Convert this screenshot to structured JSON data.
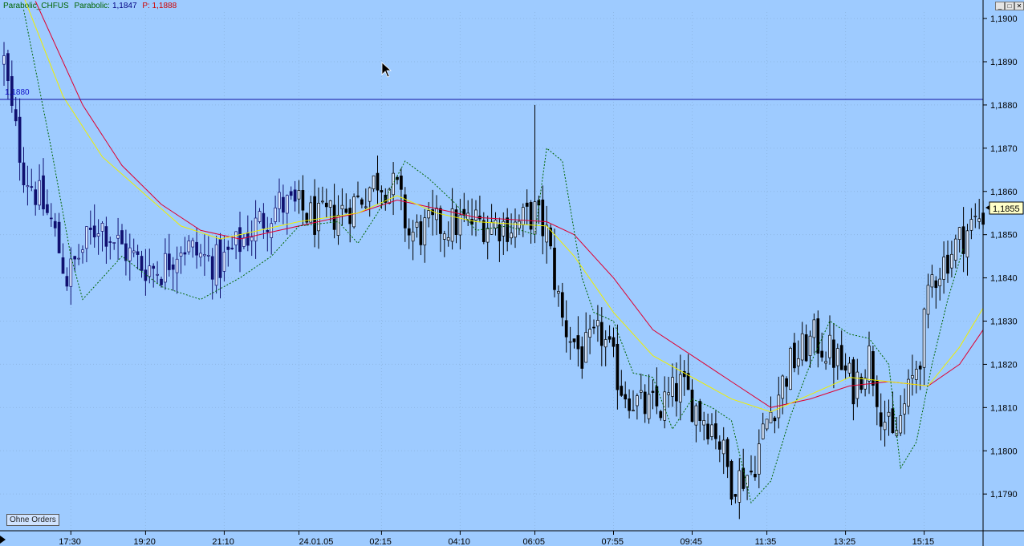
{
  "header": {
    "indicator": "Parabolic_CHFUS",
    "param_label": "Parabolic:",
    "param_value": "1,1847",
    "p_value": "P: 1,1888",
    "colors": {
      "indicator": "#006400",
      "param": "#000080",
      "p": "#d00000"
    }
  },
  "window_controls": {
    "minimize_icon": "_",
    "restore_icon": "□",
    "close_icon": "✕"
  },
  "buttons": {
    "ohne_orders": "Ohne Orders"
  },
  "hline_label": "1,1880",
  "current_price": "1,1855",
  "chart_data": {
    "type": "candlestick",
    "y_ticks": [
      "1,1790",
      "1,1800",
      "1,1810",
      "1,1820",
      "1,1830",
      "1,1840",
      "1,1850",
      "1,1860",
      "1,1870",
      "1,1880",
      "1,1890",
      "1,1900"
    ],
    "y_tick_values": [
      1.179,
      1.18,
      1.181,
      1.182,
      1.183,
      1.184,
      1.185,
      1.186,
      1.187,
      1.188,
      1.189,
      1.19
    ],
    "ylim": [
      1.17815,
      1.19015
    ],
    "x_ticks": [
      "17:30",
      "19:20",
      "21:10",
      "24.01.05",
      "02:15",
      "04:10",
      "06:05",
      "07:55",
      "09:45",
      "11:35",
      "13:25",
      "15:15"
    ],
    "x_tick_index": [
      17,
      36,
      56,
      75,
      96,
      116,
      135,
      155,
      175,
      194,
      214,
      234
    ],
    "n_bars": 250,
    "horizontal_line": 1.188,
    "current_price_value": 1.1855,
    "anchors": [
      [
        0,
        1.189
      ],
      [
        2,
        1.1878
      ],
      [
        5,
        1.1865
      ],
      [
        8,
        1.186
      ],
      [
        12,
        1.1853
      ],
      [
        16,
        1.184
      ],
      [
        19,
        1.1845
      ],
      [
        24,
        1.1853
      ],
      [
        30,
        1.1847
      ],
      [
        35,
        1.1843
      ],
      [
        40,
        1.1842
      ],
      [
        45,
        1.1848
      ],
      [
        50,
        1.1845
      ],
      [
        55,
        1.1843
      ],
      [
        60,
        1.1848
      ],
      [
        65,
        1.1853
      ],
      [
        70,
        1.1857
      ],
      [
        75,
        1.1856
      ],
      [
        80,
        1.1853
      ],
      [
        85,
        1.1855
      ],
      [
        90,
        1.1858
      ],
      [
        95,
        1.1863
      ],
      [
        100,
        1.186
      ],
      [
        103,
        1.185
      ],
      [
        110,
        1.1852
      ],
      [
        120,
        1.1853
      ],
      [
        130,
        1.1852
      ],
      [
        135,
        1.1855
      ],
      [
        138,
        1.185
      ],
      [
        142,
        1.183
      ],
      [
        147,
        1.1822
      ],
      [
        152,
        1.1827
      ],
      [
        157,
        1.1815
      ],
      [
        162,
        1.181
      ],
      [
        167,
        1.181
      ],
      [
        172,
        1.1815
      ],
      [
        176,
        1.181
      ],
      [
        181,
        1.1805
      ],
      [
        185,
        1.1793
      ],
      [
        190,
        1.1795
      ],
      [
        194,
        1.1807
      ],
      [
        200,
        1.182
      ],
      [
        206,
        1.1826
      ],
      [
        211,
        1.1822
      ],
      [
        216,
        1.1815
      ],
      [
        220,
        1.1822
      ],
      [
        223,
        1.181
      ],
      [
        226,
        1.1802
      ],
      [
        230,
        1.1813
      ],
      [
        233,
        1.1823
      ],
      [
        236,
        1.184
      ],
      [
        240,
        1.1845
      ],
      [
        244,
        1.185
      ],
      [
        249,
        1.1855
      ]
    ],
    "spike": {
      "index": 135,
      "high": 1.188
    },
    "series": [
      {
        "name": "red MA",
        "color": "#e00030",
        "type": "line",
        "points": [
          [
            8,
            1.1904
          ],
          [
            20,
            1.188
          ],
          [
            30,
            1.1866
          ],
          [
            40,
            1.1857
          ],
          [
            50,
            1.1851
          ],
          [
            60,
            1.1849
          ],
          [
            70,
            1.1851
          ],
          [
            80,
            1.1853
          ],
          [
            90,
            1.1855
          ],
          [
            100,
            1.1858
          ],
          [
            110,
            1.1856
          ],
          [
            120,
            1.1854
          ],
          [
            138,
            1.1853
          ],
          [
            145,
            1.185
          ],
          [
            155,
            1.184
          ],
          [
            165,
            1.1828
          ],
          [
            175,
            1.1822
          ],
          [
            185,
            1.1816
          ],
          [
            195,
            1.181
          ],
          [
            205,
            1.1812
          ],
          [
            215,
            1.1815
          ],
          [
            225,
            1.1816
          ],
          [
            235,
            1.1815
          ],
          [
            243,
            1.182
          ],
          [
            249,
            1.1828
          ]
        ]
      },
      {
        "name": "yellow MA",
        "color": "#f0f000",
        "type": "line",
        "points": [
          [
            5,
            1.1905
          ],
          [
            15,
            1.1882
          ],
          [
            25,
            1.1868
          ],
          [
            35,
            1.186
          ],
          [
            45,
            1.1852
          ],
          [
            55,
            1.1849
          ],
          [
            65,
            1.1851
          ],
          [
            75,
            1.1853
          ],
          [
            90,
            1.1855
          ],
          [
            100,
            1.1859
          ],
          [
            110,
            1.1855
          ],
          [
            120,
            1.1853
          ],
          [
            138,
            1.1852
          ],
          [
            145,
            1.1845
          ],
          [
            155,
            1.1832
          ],
          [
            165,
            1.1822
          ],
          [
            175,
            1.1817
          ],
          [
            185,
            1.1812
          ],
          [
            195,
            1.1809
          ],
          [
            205,
            1.1813
          ],
          [
            215,
            1.1817
          ],
          [
            225,
            1.1816
          ],
          [
            235,
            1.1815
          ],
          [
            243,
            1.1824
          ],
          [
            249,
            1.1833
          ]
        ]
      },
      {
        "name": "parabolic SAR",
        "color": "#006400",
        "type": "dashed",
        "points": [
          [
            5,
            1.1902
          ],
          [
            12,
            1.187
          ],
          [
            17,
            1.1845
          ],
          [
            20,
            1.1835
          ],
          [
            30,
            1.1845
          ],
          [
            40,
            1.1838
          ],
          [
            50,
            1.1835
          ],
          [
            60,
            1.184
          ],
          [
            68,
            1.1845
          ],
          [
            75,
            1.1852
          ],
          [
            85,
            1.1853
          ],
          [
            90,
            1.1848
          ],
          [
            95,
            1.1855
          ],
          [
            102,
            1.1867
          ],
          [
            108,
            1.1863
          ],
          [
            115,
            1.1857
          ],
          [
            120,
            1.1851
          ],
          [
            128,
            1.1852
          ],
          [
            135,
            1.185
          ],
          [
            138,
            1.187
          ],
          [
            142,
            1.1867
          ],
          [
            147,
            1.184
          ],
          [
            150,
            1.1832
          ],
          [
            155,
            1.183
          ],
          [
            160,
            1.1818
          ],
          [
            165,
            1.1817
          ],
          [
            170,
            1.1805
          ],
          [
            175,
            1.1812
          ],
          [
            180,
            1.181
          ],
          [
            185,
            1.1807
          ],
          [
            190,
            1.1788
          ],
          [
            195,
            1.1793
          ],
          [
            200,
            1.1808
          ],
          [
            205,
            1.182
          ],
          [
            210,
            1.183
          ],
          [
            215,
            1.1827
          ],
          [
            220,
            1.1826
          ],
          [
            225,
            1.182
          ],
          [
            228,
            1.1796
          ],
          [
            232,
            1.1802
          ],
          [
            236,
            1.182
          ],
          [
            240,
            1.1835
          ],
          [
            244,
            1.1847
          ]
        ]
      }
    ]
  }
}
